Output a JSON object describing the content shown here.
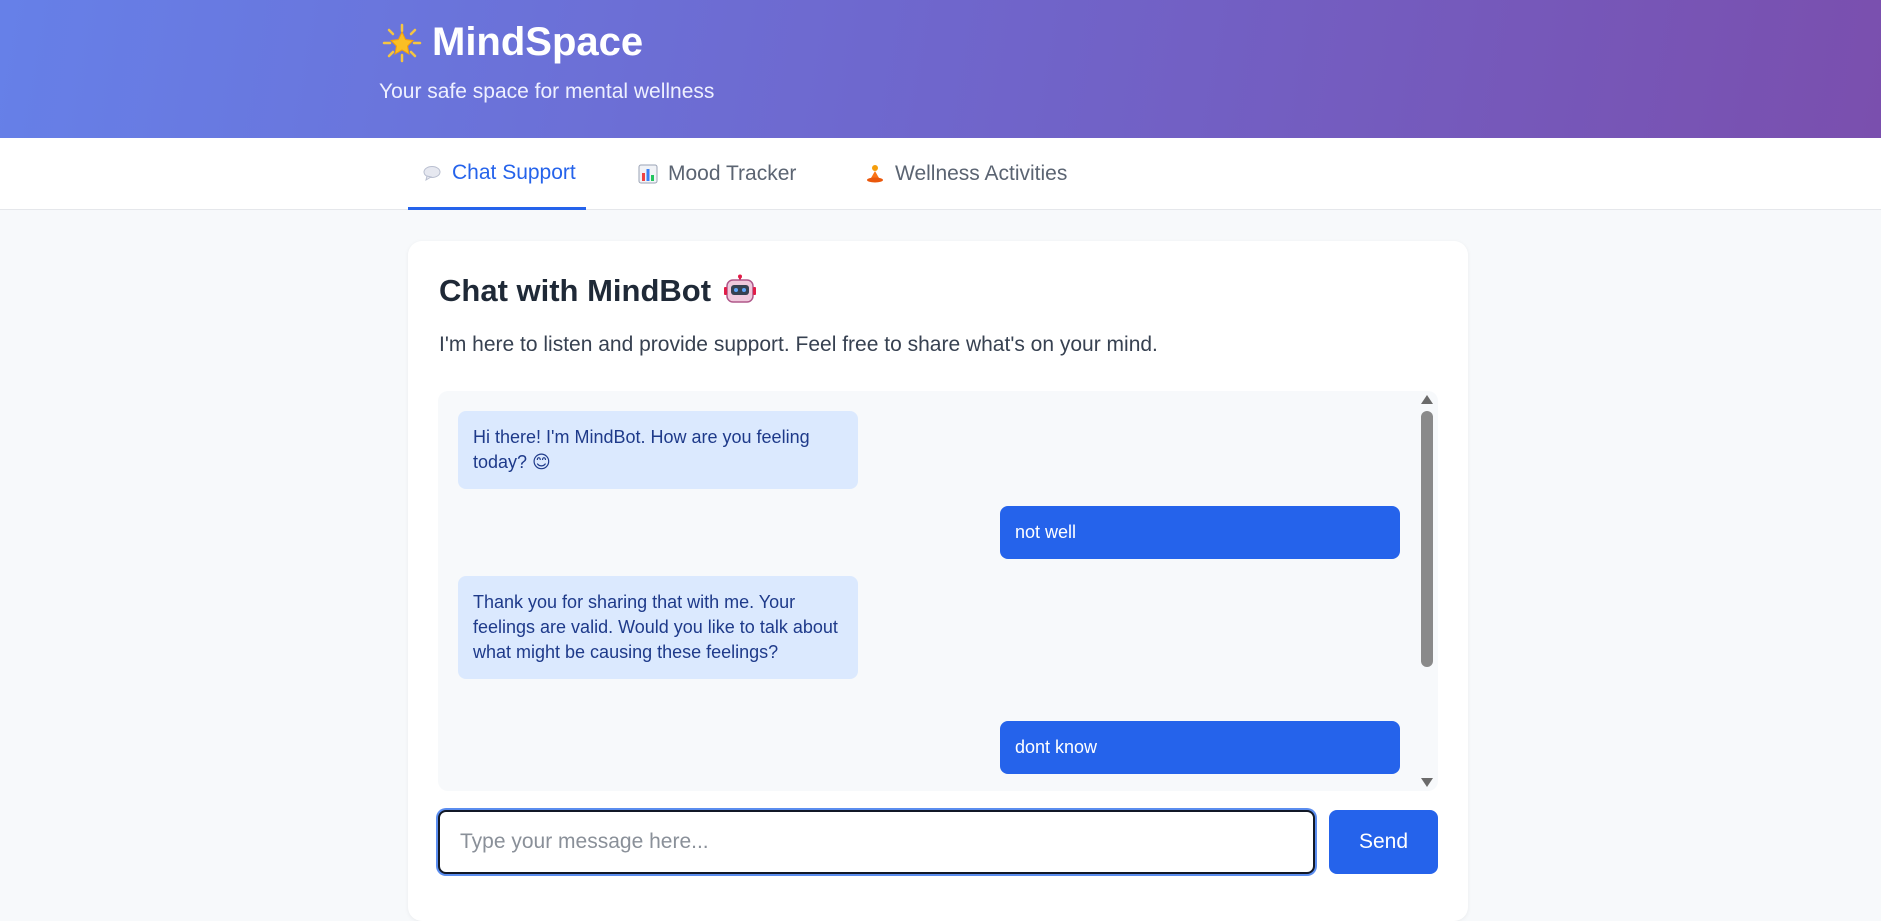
{
  "header": {
    "title": "MindSpace",
    "subtitle": "Your safe space for mental wellness",
    "logo_icon": "glowing-star-icon"
  },
  "tabs": [
    {
      "label": "Chat Support",
      "icon": "speech-bubble-icon",
      "active": true
    },
    {
      "label": "Mood Tracker",
      "icon": "bar-chart-icon",
      "active": false
    },
    {
      "label": "Wellness Activities",
      "icon": "meditation-icon",
      "active": false
    }
  ],
  "chat": {
    "title": "Chat with MindBot",
    "title_icon": "robot-icon",
    "description": "I'm here to listen and provide support. Feel free to share what's on your mind.",
    "messages": [
      {
        "sender": "bot",
        "text": "Hi there! I'm MindBot. How are you feeling today? 😊"
      },
      {
        "sender": "user",
        "text": "not well"
      },
      {
        "sender": "bot",
        "text": "Thank you for sharing that with me. Your feelings are valid. Would you like to talk about what might be causing these feelings?"
      },
      {
        "sender": "user",
        "text": "dont know"
      }
    ],
    "input_placeholder": "Type your message here...",
    "input_value": "",
    "send_label": "Send"
  },
  "colors": {
    "accent": "#2563eb",
    "bot_bubble": "#dbe9fe",
    "user_bubble": "#2563eb",
    "header_gradient_start": "#6680e8",
    "header_gradient_end": "#7a4fae"
  }
}
